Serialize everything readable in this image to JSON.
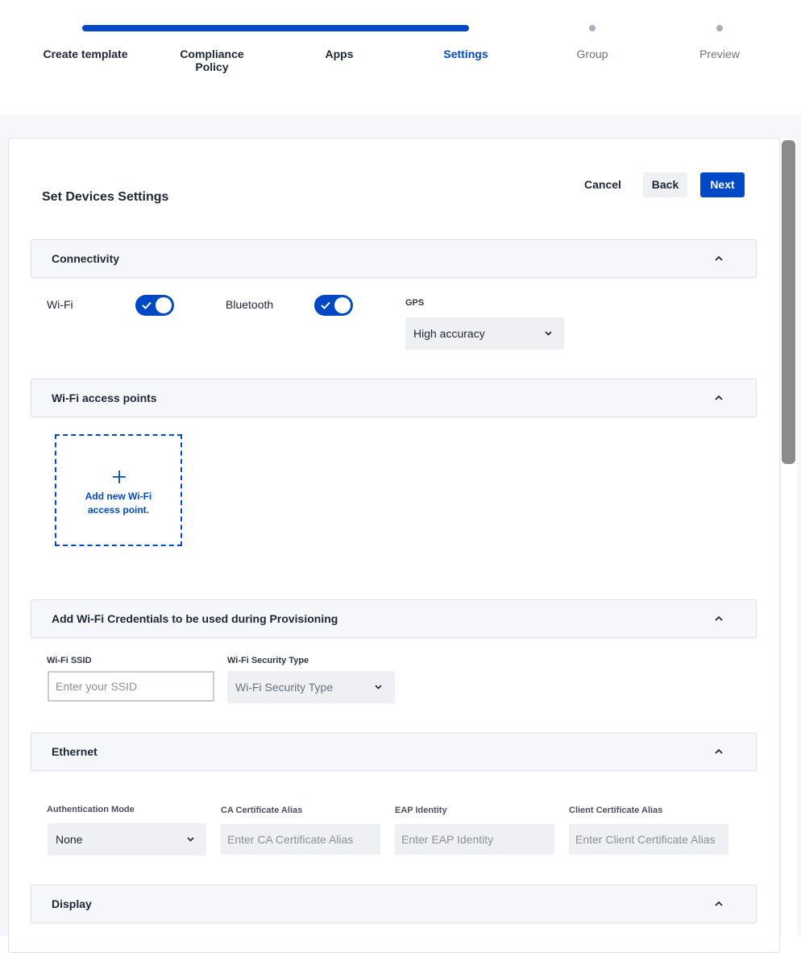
{
  "stepper": {
    "steps": [
      {
        "label": "Create template",
        "state": "done"
      },
      {
        "label": "Compliance Policy",
        "state": "done"
      },
      {
        "label": "Apps",
        "state": "done"
      },
      {
        "label": "Settings",
        "state": "active"
      },
      {
        "label": "Group",
        "state": "pending"
      },
      {
        "label": "Preview",
        "state": "pending"
      }
    ]
  },
  "header": {
    "title": "Set Devices Settings",
    "cancel_label": "Cancel",
    "back_label": "Back",
    "next_label": "Next"
  },
  "connectivity": {
    "title": "Connectivity",
    "wifi_label": "Wi-Fi",
    "wifi_enabled": true,
    "bluetooth_label": "Bluetooth",
    "bluetooth_enabled": true,
    "gps_label": "GPS",
    "gps_value": "High accuracy"
  },
  "access_points": {
    "title": "Wi-Fi access points",
    "add_label": "Add new Wi-Fi\naccess point."
  },
  "credentials": {
    "title": "Add Wi-Fi Credentials to be used during Provisioning",
    "ssid_label": "Wi-Fi SSID",
    "ssid_placeholder": "Enter your SSID",
    "security_label": "Wi-Fi Security Type",
    "security_placeholder": "Wi-Fi Security Type"
  },
  "ethernet": {
    "title": "Ethernet",
    "auth_label": "Authentication Mode",
    "auth_value": "None",
    "ca_label": "CA Certificate Alias",
    "ca_placeholder": "Enter CA Certificate Alias",
    "eap_label": "EAP Identity",
    "eap_placeholder": "Enter EAP Identity",
    "client_label": "Client Certificate Alias",
    "client_placeholder": "Enter Client Certificate Alias"
  },
  "display": {
    "title": "Display"
  },
  "colors": {
    "accent": "#0049c6",
    "text": "#1d2636",
    "section_bg": "#f5f7fa",
    "field_bg": "#eef0f3"
  },
  "icons": [
    "chevron-up-icon",
    "chevron-down-icon",
    "check-icon",
    "plus-icon"
  ]
}
